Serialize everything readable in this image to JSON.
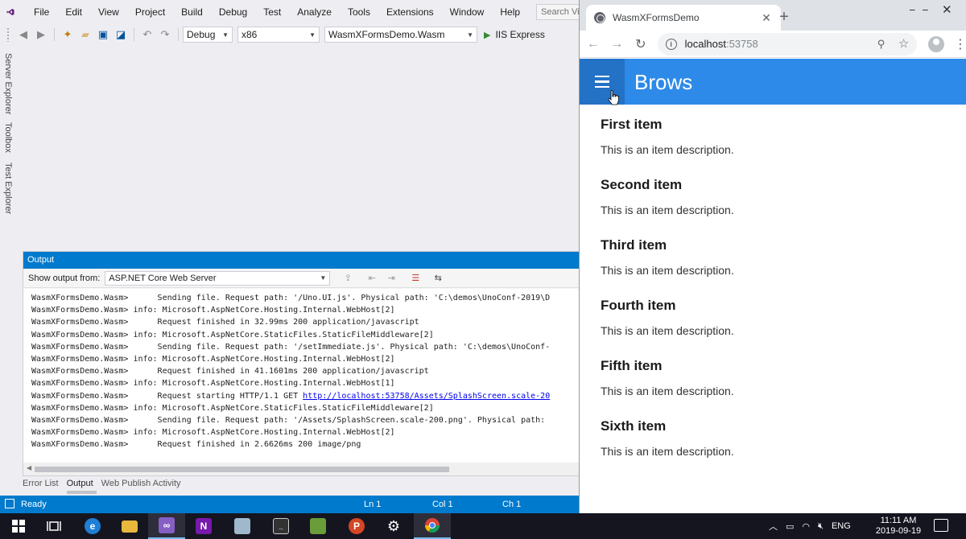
{
  "vs": {
    "menu": [
      "File",
      "Edit",
      "View",
      "Project",
      "Build",
      "Debug",
      "Test",
      "Analyze",
      "Tools",
      "Extensions",
      "Window",
      "Help"
    ],
    "search_placeholder": "Search Visual Stud",
    "toolbar": {
      "config": "Debug",
      "platform": "x86",
      "project": "WasmXFormsDemo.Wasm",
      "run_label": "IIS Express"
    },
    "side_tabs": [
      "Server Explorer",
      "Toolbox",
      "Test Explorer"
    ],
    "output": {
      "title": "Output",
      "show_from_label": "Show output from:",
      "source": "ASP.NET Core Web Server",
      "lines": [
        {
          "prefix": "WasmXFormsDemo.Wasm>",
          "text": "      Sending file. Request path: '/Uno.UI.js'. Physical path: 'C:\\demos\\UnoConf-2019\\D"
        },
        {
          "prefix": "WasmXFormsDemo.Wasm>",
          "text": " info: Microsoft.AspNetCore.Hosting.Internal.WebHost[2]"
        },
        {
          "prefix": "WasmXFormsDemo.Wasm>",
          "text": "      Request finished in 32.99ms 200 application/javascript"
        },
        {
          "prefix": "WasmXFormsDemo.Wasm>",
          "text": " info: Microsoft.AspNetCore.StaticFiles.StaticFileMiddleware[2]"
        },
        {
          "prefix": "WasmXFormsDemo.Wasm>",
          "text": "      Sending file. Request path: '/setImmediate.js'. Physical path: 'C:\\demos\\UnoConf-"
        },
        {
          "prefix": "WasmXFormsDemo.Wasm>",
          "text": " info: Microsoft.AspNetCore.Hosting.Internal.WebHost[2]"
        },
        {
          "prefix": "WasmXFormsDemo.Wasm>",
          "text": "      Request finished in 41.1601ms 200 application/javascript"
        },
        {
          "prefix": "WasmXFormsDemo.Wasm>",
          "text": " info: Microsoft.AspNetCore.Hosting.Internal.WebHost[1]"
        },
        {
          "prefix": "WasmXFormsDemo.Wasm>",
          "text": "      Request starting HTTP/1.1 GET ",
          "link": "http://localhost:53758/Assets/SplashScreen.scale-20"
        },
        {
          "prefix": "WasmXFormsDemo.Wasm>",
          "text": " info: Microsoft.AspNetCore.StaticFiles.StaticFileMiddleware[2]"
        },
        {
          "prefix": "WasmXFormsDemo.Wasm>",
          "text": "      Sending file. Request path: '/Assets/SplashScreen.scale-200.png'. Physical path:"
        },
        {
          "prefix": "WasmXFormsDemo.Wasm>",
          "text": " info: Microsoft.AspNetCore.Hosting.Internal.WebHost[2]"
        },
        {
          "prefix": "WasmXFormsDemo.Wasm>",
          "text": "      Request finished in 2.6626ms 200 image/png"
        }
      ]
    },
    "bottom_tabs": [
      "Error List",
      "Output",
      "Web Publish Activity"
    ],
    "status": {
      "ready": "Ready",
      "ln": "Ln 1",
      "col": "Col 1",
      "ch": "Ch 1"
    }
  },
  "chrome": {
    "tab_title": "WasmXFormsDemo",
    "tab_close": "✕",
    "new_tab": "+",
    "url_host": "localhost",
    "url_port": ":53758",
    "win_min": "⎯ ⎯",
    "win_close": "✕"
  },
  "app": {
    "title": "Brows",
    "items": [
      {
        "title": "First item",
        "description": "This is an item description."
      },
      {
        "title": "Second item",
        "description": "This is an item description."
      },
      {
        "title": "Third item",
        "description": "This is an item description."
      },
      {
        "title": "Fourth item",
        "description": "This is an item description."
      },
      {
        "title": "Fifth item",
        "description": "This is an item description."
      },
      {
        "title": "Sixth item",
        "description": "This is an item description."
      }
    ]
  },
  "taskbar": {
    "apps": [
      "start-icon",
      "task-view-icon",
      "edge-icon",
      "file-explorer-icon",
      "visual-studio-icon",
      "onenote-icon",
      "snipping-icon",
      "terminal-icon",
      "notepad-icon",
      "powerpoint-icon",
      "settings-icon",
      "chrome-icon"
    ],
    "lang": "ENG",
    "time": "11:11 AM",
    "date": "2019-09-19"
  },
  "colors": {
    "vs_accent": "#007acc",
    "app_bar": "#2d8ae8",
    "app_bar_button": "#2372c6",
    "taskbar": "#151520"
  }
}
